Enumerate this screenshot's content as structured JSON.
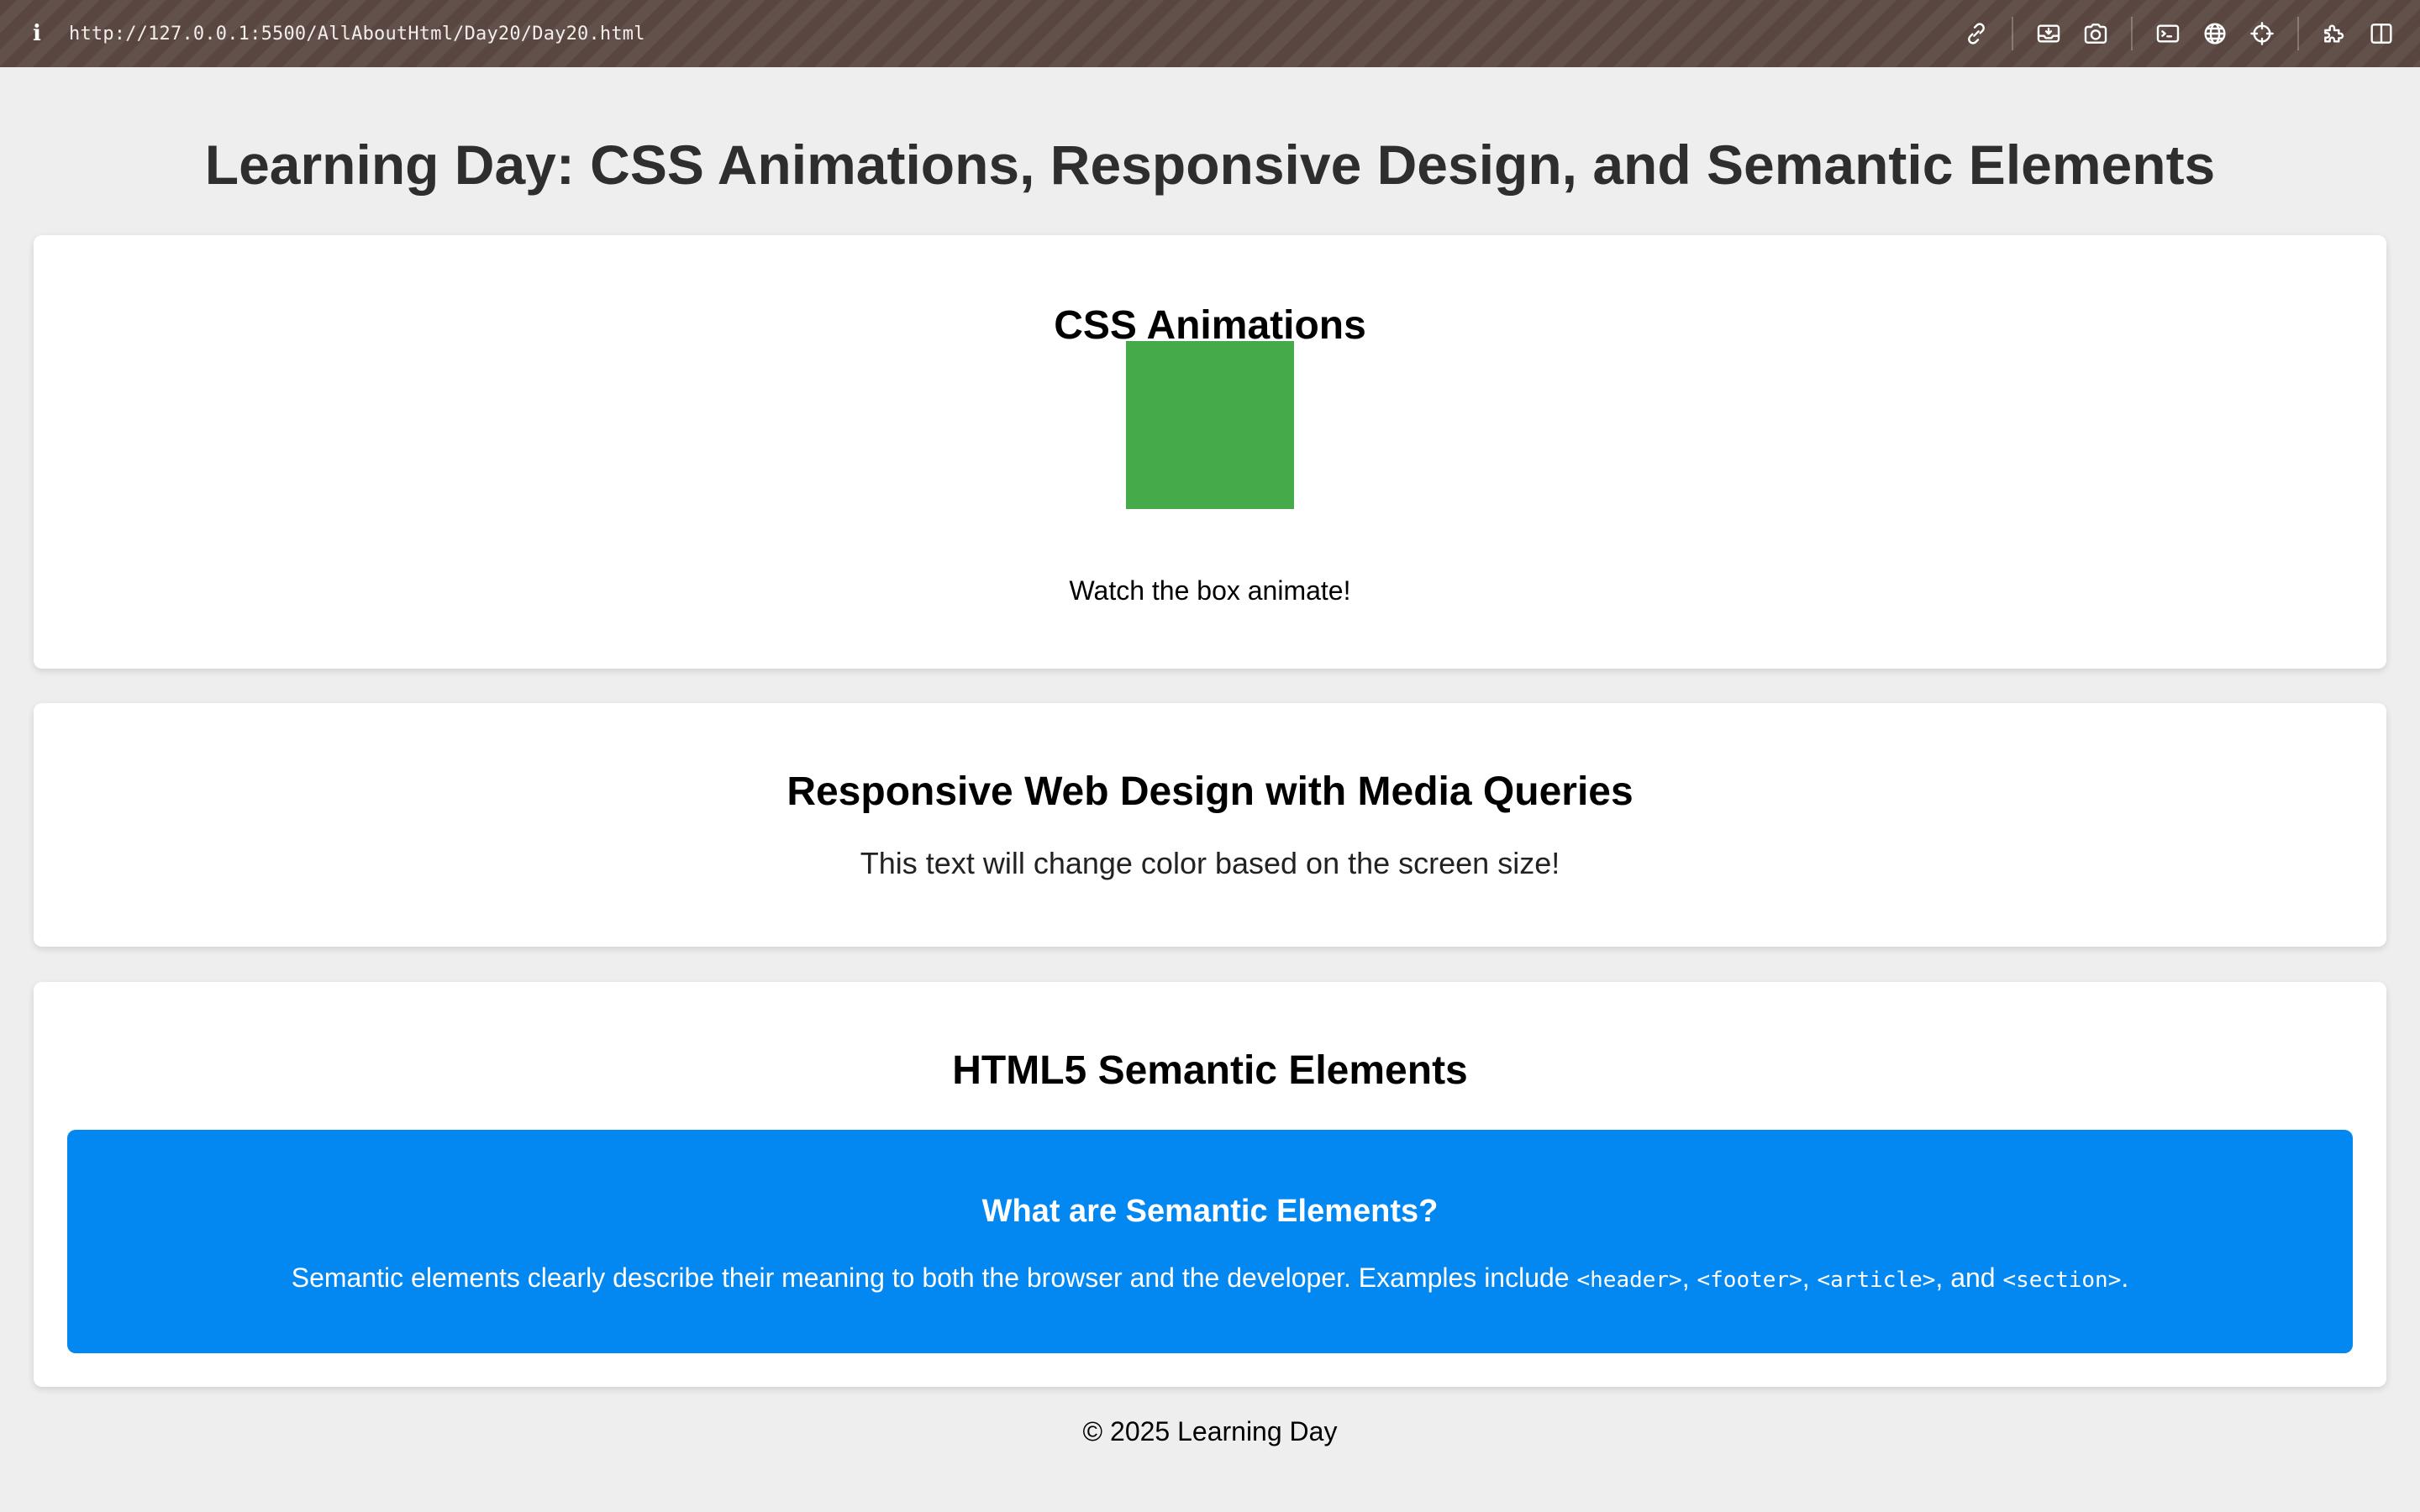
{
  "browser": {
    "url": "http://127.0.0.1:5500/AllAboutHtml/Day20/Day20.html",
    "info_glyph": "i"
  },
  "page": {
    "title": "Learning Day: CSS Animations, Responsive Design, and Semantic Elements"
  },
  "animations": {
    "heading": "CSS Animations",
    "caption": "Watch the box animate!",
    "box_color": "#44aa4a"
  },
  "responsive": {
    "heading": "Responsive Web Design with Media Queries",
    "text": "This text will change color based on the screen size!"
  },
  "semantic": {
    "heading": "HTML5 Semantic Elements",
    "box_heading": "What are Semantic Elements?",
    "text_intro": "Semantic elements clearly describe their meaning to both the browser and the developer. Examples include ",
    "tag_header": "<header>",
    "sep1": ", ",
    "tag_footer": "<footer>",
    "sep2": ", ",
    "tag_article": "<article>",
    "sep3": ", and ",
    "tag_section": "<section>",
    "end": ".",
    "box_color": "#0388f2"
  },
  "footer": {
    "text": "© 2025 Learning Day"
  },
  "toolbar_icons": [
    "link-icon",
    "inbox-download-icon",
    "camera-icon",
    "terminal-icon",
    "globe-icon",
    "crosshair-icon",
    "extensions-icon",
    "split-view-icon"
  ]
}
